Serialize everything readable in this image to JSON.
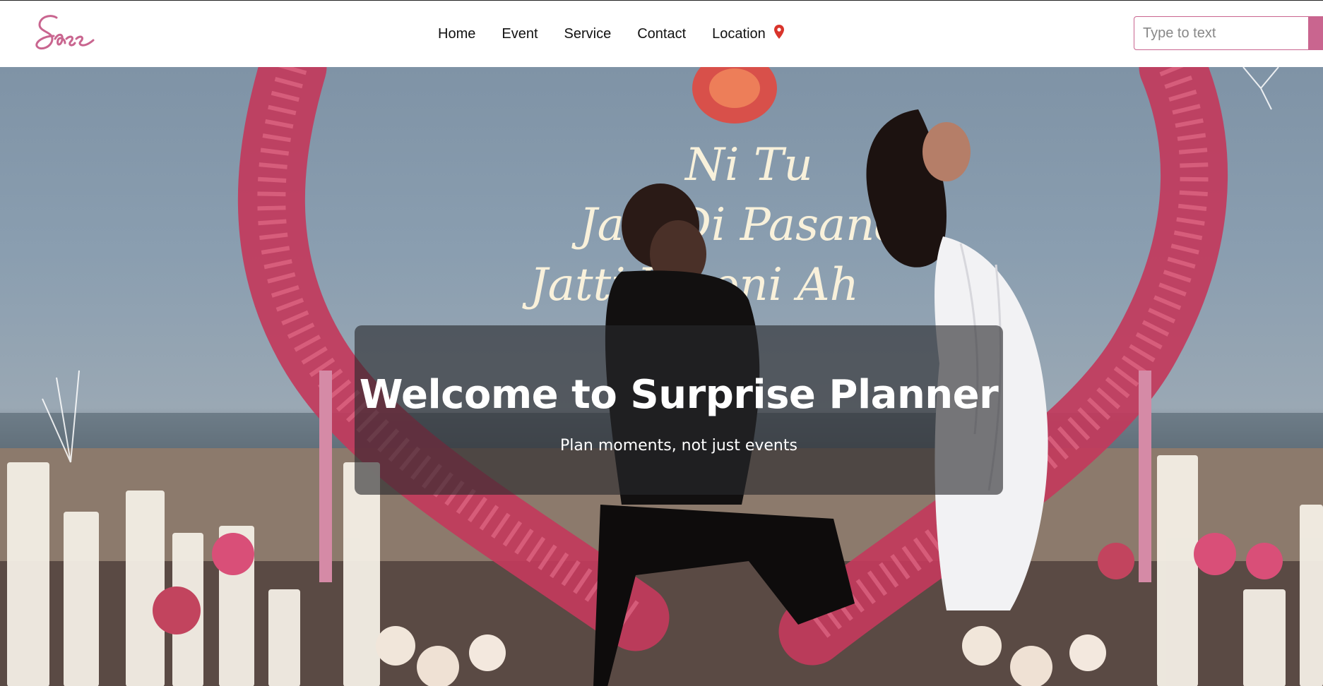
{
  "brand": {
    "logo_text": "Sass",
    "accent_color": "#c9658f"
  },
  "nav": {
    "items": [
      {
        "label": "Home"
      },
      {
        "label": "Event"
      },
      {
        "label": "Service"
      },
      {
        "label": "Contact"
      },
      {
        "label": "Location",
        "icon": "location-pin-icon",
        "icon_color": "#d9342b"
      }
    ]
  },
  "search": {
    "placeholder": "Type to text",
    "value": ""
  },
  "hero": {
    "title": "Welcome to Surprise Planner",
    "subtitle": "Plan moments, not just events",
    "neon_sign": [
      "Ni Tu",
      "Jatt Di Pasand",
      "Jatti Viyoni Ah"
    ]
  }
}
